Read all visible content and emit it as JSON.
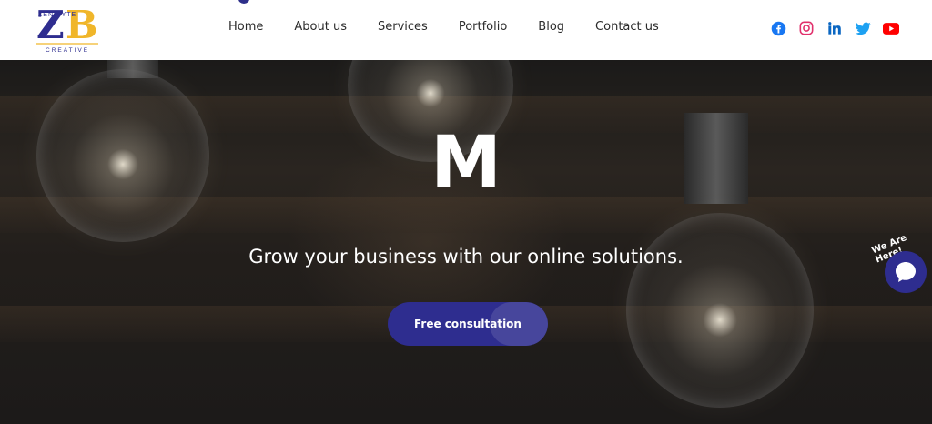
{
  "logo": {
    "letters": "ZB",
    "name": "ZENIBYTE",
    "tagline": "CREATIVE"
  },
  "nav": [
    "Home",
    "About us",
    "Services",
    "Portfolio",
    "Blog",
    "Contact us"
  ],
  "social_icons": [
    "facebook-icon",
    "instagram-icon",
    "linkedin-icon",
    "twitter-icon",
    "youtube-icon"
  ],
  "hero": {
    "big_letter": "M",
    "subtitle": "Grow your business with our online solutions.",
    "cta_label": "Free consultation"
  },
  "chat": {
    "label": "We Are Here!"
  },
  "colors": {
    "brand_navy": "#2e2d8f",
    "brand_gold": "#f0b62a",
    "facebook": "#1877f2",
    "instagram": "#e1306c",
    "linkedin": "#0a66c2",
    "twitter": "#1da1f2",
    "youtube": "#ff0000"
  }
}
